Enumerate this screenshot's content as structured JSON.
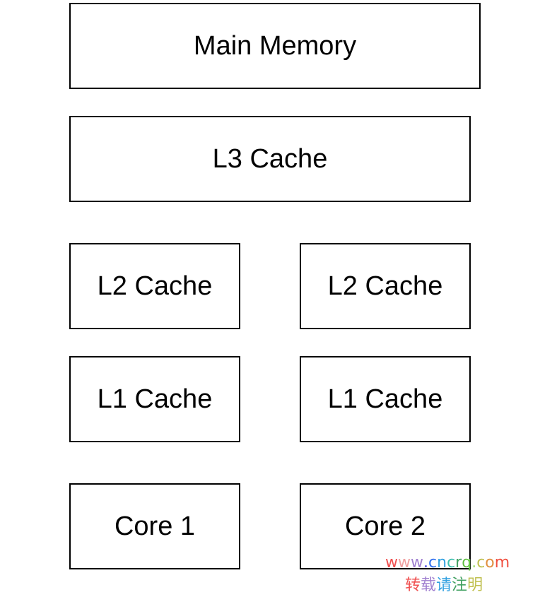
{
  "diagram": {
    "main_memory": "Main Memory",
    "l3_cache": "L3 Cache",
    "l2_cache_left": "L2 Cache",
    "l2_cache_right": "L2 Cache",
    "l1_cache_left": "L1 Cache",
    "l1_cache_right": "L1 Cache",
    "core_1": "Core 1",
    "core_2": "Core 2"
  },
  "watermark": {
    "line1": "www.cncrq.com",
    "line2": "转载请注明",
    "colors": [
      "#f05050",
      "#f0a0a0",
      "#a080d0",
      "#4040e0",
      "#3070f0",
      "#30a0e0",
      "#40c0b0",
      "#40a060",
      "#60c040",
      "#a0e070",
      "#c0c050",
      "#e09040",
      "#f05040"
    ]
  }
}
